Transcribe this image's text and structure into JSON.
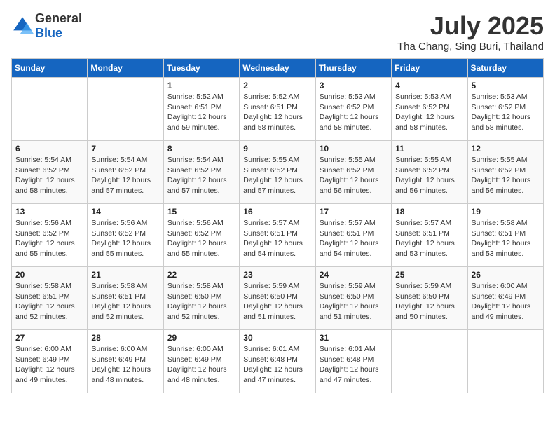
{
  "header": {
    "logo_general": "General",
    "logo_blue": "Blue",
    "title": "July 2025",
    "subtitle": "Tha Chang, Sing Buri, Thailand"
  },
  "days_of_week": [
    "Sunday",
    "Monday",
    "Tuesday",
    "Wednesday",
    "Thursday",
    "Friday",
    "Saturday"
  ],
  "weeks": [
    [
      {
        "day": "",
        "sunrise": "",
        "sunset": "",
        "daylight": ""
      },
      {
        "day": "",
        "sunrise": "",
        "sunset": "",
        "daylight": ""
      },
      {
        "day": "1",
        "sunrise": "Sunrise: 5:52 AM",
        "sunset": "Sunset: 6:51 PM",
        "daylight": "Daylight: 12 hours and 59 minutes."
      },
      {
        "day": "2",
        "sunrise": "Sunrise: 5:52 AM",
        "sunset": "Sunset: 6:51 PM",
        "daylight": "Daylight: 12 hours and 58 minutes."
      },
      {
        "day": "3",
        "sunrise": "Sunrise: 5:53 AM",
        "sunset": "Sunset: 6:52 PM",
        "daylight": "Daylight: 12 hours and 58 minutes."
      },
      {
        "day": "4",
        "sunrise": "Sunrise: 5:53 AM",
        "sunset": "Sunset: 6:52 PM",
        "daylight": "Daylight: 12 hours and 58 minutes."
      },
      {
        "day": "5",
        "sunrise": "Sunrise: 5:53 AM",
        "sunset": "Sunset: 6:52 PM",
        "daylight": "Daylight: 12 hours and 58 minutes."
      }
    ],
    [
      {
        "day": "6",
        "sunrise": "Sunrise: 5:54 AM",
        "sunset": "Sunset: 6:52 PM",
        "daylight": "Daylight: 12 hours and 58 minutes."
      },
      {
        "day": "7",
        "sunrise": "Sunrise: 5:54 AM",
        "sunset": "Sunset: 6:52 PM",
        "daylight": "Daylight: 12 hours and 57 minutes."
      },
      {
        "day": "8",
        "sunrise": "Sunrise: 5:54 AM",
        "sunset": "Sunset: 6:52 PM",
        "daylight": "Daylight: 12 hours and 57 minutes."
      },
      {
        "day": "9",
        "sunrise": "Sunrise: 5:55 AM",
        "sunset": "Sunset: 6:52 PM",
        "daylight": "Daylight: 12 hours and 57 minutes."
      },
      {
        "day": "10",
        "sunrise": "Sunrise: 5:55 AM",
        "sunset": "Sunset: 6:52 PM",
        "daylight": "Daylight: 12 hours and 56 minutes."
      },
      {
        "day": "11",
        "sunrise": "Sunrise: 5:55 AM",
        "sunset": "Sunset: 6:52 PM",
        "daylight": "Daylight: 12 hours and 56 minutes."
      },
      {
        "day": "12",
        "sunrise": "Sunrise: 5:55 AM",
        "sunset": "Sunset: 6:52 PM",
        "daylight": "Daylight: 12 hours and 56 minutes."
      }
    ],
    [
      {
        "day": "13",
        "sunrise": "Sunrise: 5:56 AM",
        "sunset": "Sunset: 6:52 PM",
        "daylight": "Daylight: 12 hours and 55 minutes."
      },
      {
        "day": "14",
        "sunrise": "Sunrise: 5:56 AM",
        "sunset": "Sunset: 6:52 PM",
        "daylight": "Daylight: 12 hours and 55 minutes."
      },
      {
        "day": "15",
        "sunrise": "Sunrise: 5:56 AM",
        "sunset": "Sunset: 6:52 PM",
        "daylight": "Daylight: 12 hours and 55 minutes."
      },
      {
        "day": "16",
        "sunrise": "Sunrise: 5:57 AM",
        "sunset": "Sunset: 6:51 PM",
        "daylight": "Daylight: 12 hours and 54 minutes."
      },
      {
        "day": "17",
        "sunrise": "Sunrise: 5:57 AM",
        "sunset": "Sunset: 6:51 PM",
        "daylight": "Daylight: 12 hours and 54 minutes."
      },
      {
        "day": "18",
        "sunrise": "Sunrise: 5:57 AM",
        "sunset": "Sunset: 6:51 PM",
        "daylight": "Daylight: 12 hours and 53 minutes."
      },
      {
        "day": "19",
        "sunrise": "Sunrise: 5:58 AM",
        "sunset": "Sunset: 6:51 PM",
        "daylight": "Daylight: 12 hours and 53 minutes."
      }
    ],
    [
      {
        "day": "20",
        "sunrise": "Sunrise: 5:58 AM",
        "sunset": "Sunset: 6:51 PM",
        "daylight": "Daylight: 12 hours and 52 minutes."
      },
      {
        "day": "21",
        "sunrise": "Sunrise: 5:58 AM",
        "sunset": "Sunset: 6:51 PM",
        "daylight": "Daylight: 12 hours and 52 minutes."
      },
      {
        "day": "22",
        "sunrise": "Sunrise: 5:58 AM",
        "sunset": "Sunset: 6:50 PM",
        "daylight": "Daylight: 12 hours and 52 minutes."
      },
      {
        "day": "23",
        "sunrise": "Sunrise: 5:59 AM",
        "sunset": "Sunset: 6:50 PM",
        "daylight": "Daylight: 12 hours and 51 minutes."
      },
      {
        "day": "24",
        "sunrise": "Sunrise: 5:59 AM",
        "sunset": "Sunset: 6:50 PM",
        "daylight": "Daylight: 12 hours and 51 minutes."
      },
      {
        "day": "25",
        "sunrise": "Sunrise: 5:59 AM",
        "sunset": "Sunset: 6:50 PM",
        "daylight": "Daylight: 12 hours and 50 minutes."
      },
      {
        "day": "26",
        "sunrise": "Sunrise: 6:00 AM",
        "sunset": "Sunset: 6:49 PM",
        "daylight": "Daylight: 12 hours and 49 minutes."
      }
    ],
    [
      {
        "day": "27",
        "sunrise": "Sunrise: 6:00 AM",
        "sunset": "Sunset: 6:49 PM",
        "daylight": "Daylight: 12 hours and 49 minutes."
      },
      {
        "day": "28",
        "sunrise": "Sunrise: 6:00 AM",
        "sunset": "Sunset: 6:49 PM",
        "daylight": "Daylight: 12 hours and 48 minutes."
      },
      {
        "day": "29",
        "sunrise": "Sunrise: 6:00 AM",
        "sunset": "Sunset: 6:49 PM",
        "daylight": "Daylight: 12 hours and 48 minutes."
      },
      {
        "day": "30",
        "sunrise": "Sunrise: 6:01 AM",
        "sunset": "Sunset: 6:48 PM",
        "daylight": "Daylight: 12 hours and 47 minutes."
      },
      {
        "day": "31",
        "sunrise": "Sunrise: 6:01 AM",
        "sunset": "Sunset: 6:48 PM",
        "daylight": "Daylight: 12 hours and 47 minutes."
      },
      {
        "day": "",
        "sunrise": "",
        "sunset": "",
        "daylight": ""
      },
      {
        "day": "",
        "sunrise": "",
        "sunset": "",
        "daylight": ""
      }
    ]
  ]
}
